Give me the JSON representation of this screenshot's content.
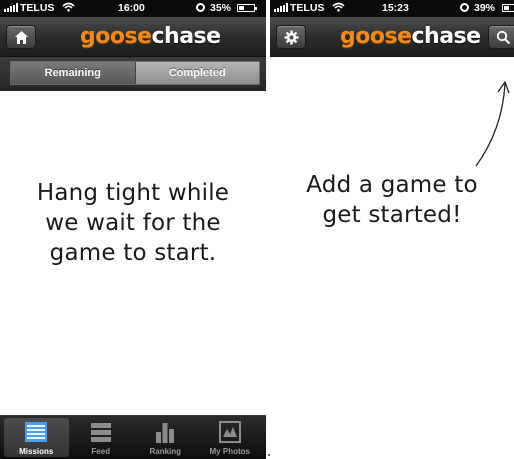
{
  "left_screen": {
    "status": {
      "carrier": "TELUS",
      "time": "16:00",
      "battery": "35%",
      "battery_level": 0.35
    },
    "logo": {
      "part1": "goose",
      "part2": "chase"
    },
    "home_icon": "home-icon",
    "segments": [
      "Remaining",
      "Completed"
    ],
    "message_lines": [
      "Hang tight while",
      "we wait for the",
      "game to start."
    ],
    "tabs": [
      {
        "label": "Missions",
        "icon": "missions-list-icon"
      },
      {
        "label": "Feed",
        "icon": "feed-icon"
      },
      {
        "label": "Ranking",
        "icon": "ranking-bars-icon"
      },
      {
        "label": "My Photos",
        "icon": "photos-icon"
      }
    ]
  },
  "right_screen": {
    "status": {
      "carrier": "TELUS",
      "time": "15:23",
      "battery": "39%",
      "battery_level": 0.39
    },
    "logo": {
      "part1": "goose",
      "part2": "chase"
    },
    "settings_icon": "gear-icon",
    "search_icon": "search-icon",
    "message_lines": [
      "Add a game to",
      "get started!"
    ]
  },
  "colors": {
    "brand_orange": "#f08a1e",
    "active_tab_blue": "#4aa0f0"
  }
}
